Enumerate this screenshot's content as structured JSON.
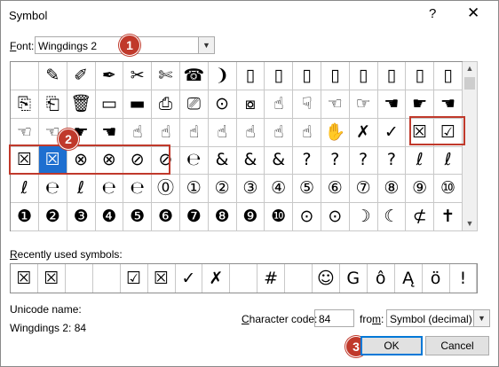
{
  "dialog": {
    "title": "Symbol",
    "help_glyph": "?",
    "close_glyph": "✕"
  },
  "font": {
    "label_accel": "F",
    "label_rest": "ont:",
    "value": "Wingdings 2",
    "icon": "chevron-down-icon"
  },
  "annotations": {
    "one": "1",
    "two": "2",
    "three": "3",
    "color": "#c0392b"
  },
  "grid": {
    "rows": [
      [
        "",
        "✎",
        "✐",
        "✒",
        "✂",
        "✄",
        "☎",
        "❩",
        "▯",
        "▯",
        "▯",
        "▯",
        "▯",
        "▯",
        "▯",
        "▯"
      ],
      [
        "⎘",
        "⎗",
        "🗑",
        "▭",
        "▬",
        "⎙",
        "⎚",
        "⊙",
        "⧇",
        "☝",
        "☟",
        "☜",
        "☞",
        "☚",
        "☛",
        "☚"
      ],
      [
        "☜",
        "☜",
        "☛",
        "☚",
        "☝",
        "☝",
        "☝",
        "☝",
        "☝",
        "☝",
        "☝",
        "✋",
        "✗",
        "✓",
        "☒",
        "☑"
      ],
      [
        "☒",
        "☒",
        "⊗",
        "⊗",
        "⊘",
        "⊘",
        "℮",
        "&",
        "&",
        "&",
        "?",
        "?",
        "?",
        "?",
        "ℓ",
        "ℓ"
      ],
      [
        "ℓ",
        "℮",
        "ℓ",
        "℮",
        "℮",
        "⓪",
        "①",
        "②",
        "③",
        "④",
        "⑤",
        "⑥",
        "⑦",
        "⑧",
        "⑨",
        "⑩"
      ],
      [
        "❶",
        "❷",
        "❸",
        "❹",
        "❺",
        "❻",
        "❼",
        "❽",
        "❾",
        "❿",
        "⊙",
        "⊙",
        "☽",
        "☾",
        "⊄",
        "✝"
      ]
    ],
    "selected_row": 3,
    "selected_col": 1,
    "selected_color": "#1e6fd0"
  },
  "recent": {
    "label_accel": "R",
    "label_rest": "ecently used symbols:",
    "items": [
      "☒",
      "☒",
      "",
      "",
      "☑",
      "☒",
      "✓",
      "✗",
      "",
      "#",
      "",
      "☺",
      "G",
      "ô",
      "Ą",
      "ö",
      "!"
    ]
  },
  "unicode": {
    "name_label": "Unicode name:",
    "name_value": "Wingdings 2: 84"
  },
  "charcode": {
    "label_accel": "C",
    "label_rest": "haracter code:",
    "value": "84"
  },
  "from": {
    "label_pre": "fro",
    "label_accel": "m",
    "label_post": ":",
    "value": "Symbol (decimal)"
  },
  "buttons": {
    "ok": "OK",
    "cancel": "Cancel",
    "accent": "#0078d7"
  }
}
